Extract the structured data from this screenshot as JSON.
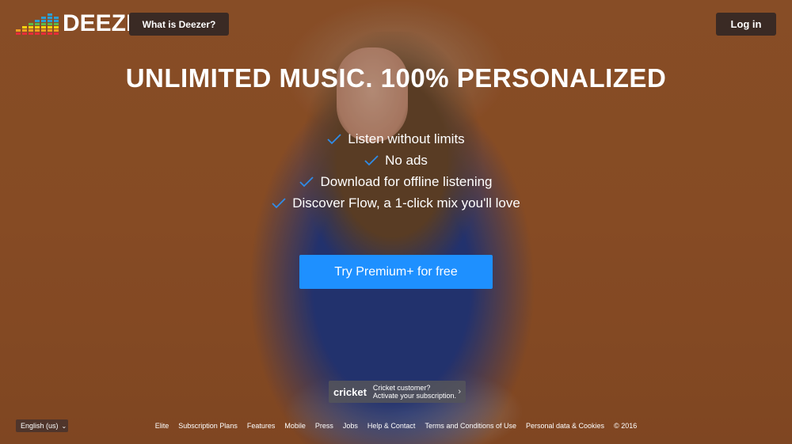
{
  "brand": {
    "logo_text": "DEEZER",
    "bar_colors": [
      "#e52d3a",
      "#f39d1f",
      "#ffd10f",
      "#5bb84b",
      "#2a9fd6"
    ]
  },
  "header": {
    "what_label": "What is Deezer?",
    "login_label": "Log in"
  },
  "hero": {
    "headline": "UNLIMITED MUSIC. 100% PERSONALIZED",
    "features": [
      "Listen without limits",
      "No ads",
      "Download for offline listening",
      "Discover Flow, a 1-click mix you'll love"
    ],
    "cta_label": "Try Premium+ for free",
    "check_color": "#1e90ff"
  },
  "cricket": {
    "logo": "cricket",
    "line1": "Cricket customer?",
    "line2": "Activate your subscription.",
    "chevron": "›"
  },
  "language": {
    "label": "English (us)",
    "chevron": "⌄"
  },
  "footer": {
    "links": [
      "Elite",
      "Subscription Plans",
      "Features",
      "Mobile",
      "Press",
      "Jobs",
      "Help & Contact",
      "Terms and Conditions of Use",
      "Personal data & Cookies",
      "© 2016"
    ]
  }
}
